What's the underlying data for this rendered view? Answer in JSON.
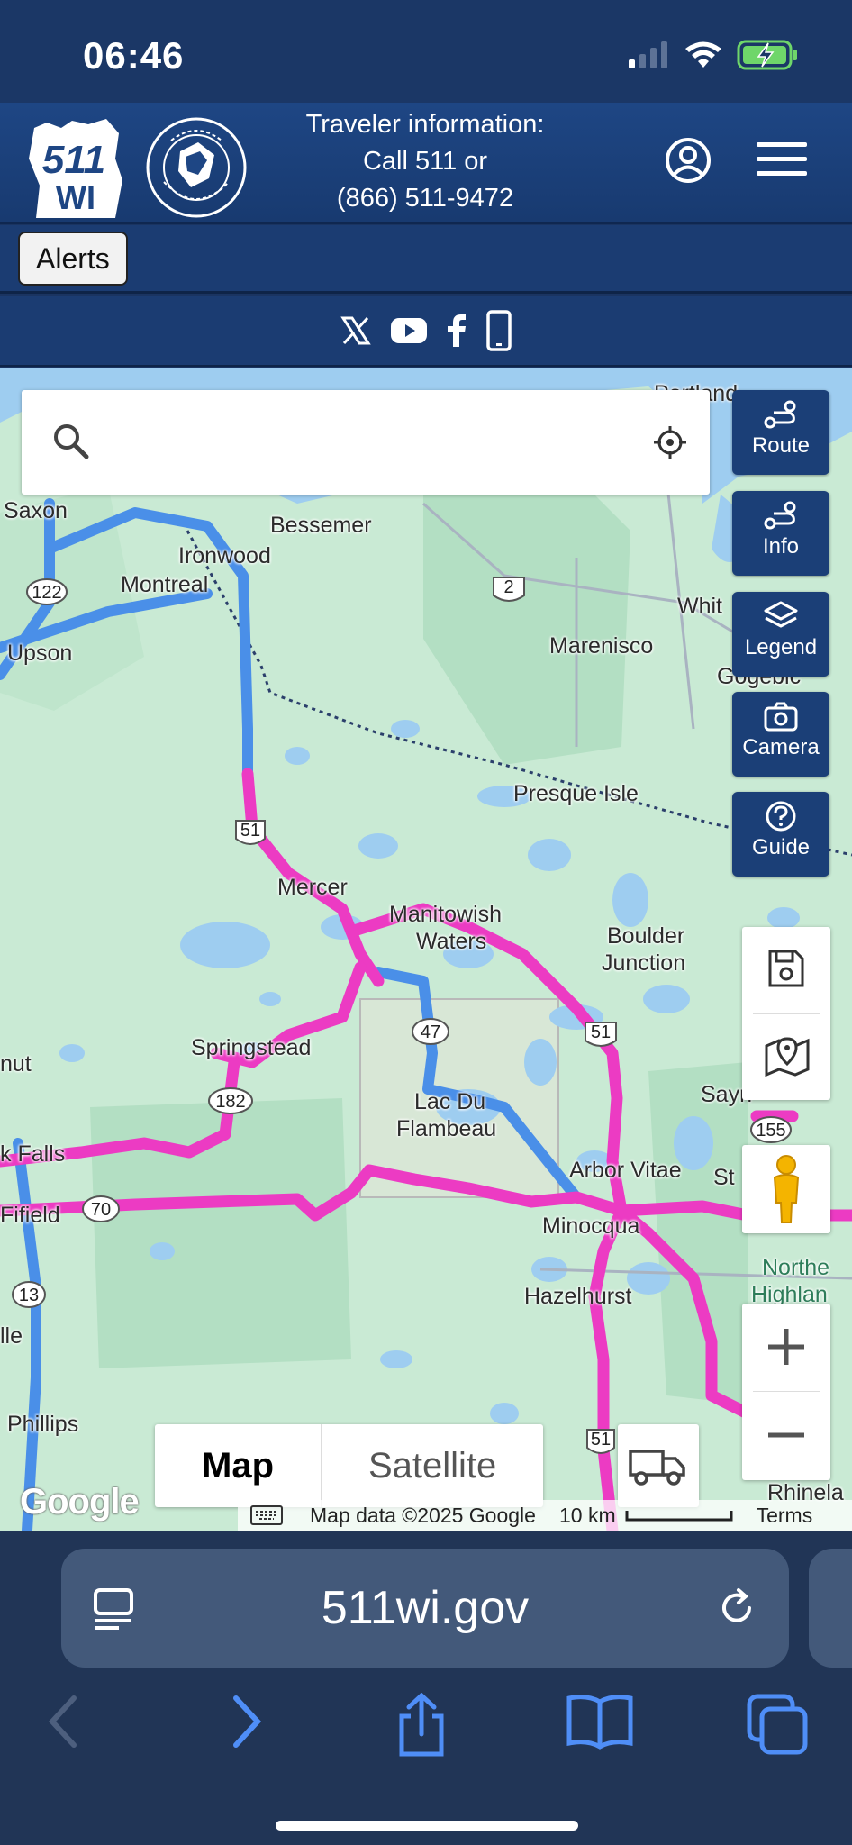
{
  "status": {
    "time": "06:46"
  },
  "header": {
    "logo_text": "511 WI",
    "agency_seal": "Wisconsin Department of Transportation",
    "info_line1": "Traveler information:",
    "info_line2": "Call 511 or",
    "info_line3": "(866) 511-9472"
  },
  "alerts": {
    "label": "Alerts"
  },
  "social": [
    "x-icon",
    "youtube-icon",
    "facebook-icon",
    "mobile-app-icon"
  ],
  "search": {
    "placeholder": "",
    "value": ""
  },
  "tools": [
    {
      "label": "Route",
      "icon": "route-icon"
    },
    {
      "label": "Info",
      "icon": "info-route-icon"
    },
    {
      "label": "Legend",
      "icon": "layers-icon"
    },
    {
      "label": "Camera",
      "icon": "camera-icon"
    },
    {
      "label": "Guide",
      "icon": "question-icon"
    }
  ],
  "map": {
    "labels": {
      "saxon": "Saxon",
      "bessemer": "Bessemer",
      "ironwood": "Ironwood",
      "montreal": "Montreal",
      "upson": "Upson",
      "marenisco": "Marenisco",
      "white": "Whit",
      "gogebic": "Gogebic",
      "presque_isle": "Presque Isle",
      "mercer": "Mercer",
      "manitowish": "Manitowish",
      "waters": "Waters",
      "boulder": "Boulder",
      "junction": "Junction",
      "springstead": "Springstead",
      "lac_du": "Lac Du",
      "flambeau": "Flambeau",
      "arbor_vitae": "Arbor Vitae",
      "minocqua": "Minocqua",
      "hazelhurst": "Hazelhurst",
      "park_falls": "k Falls",
      "fifield": "Fifield",
      "phillips": "Phillips",
      "lle": "lle",
      "nut": "nut",
      "sayner": "Sayn",
      "st_germain": "St",
      "northern": "Northe",
      "highland": "Highlan",
      "rhinelander": "Rhinela",
      "portland": "Portland"
    },
    "shields": {
      "us51a": "51",
      "us51b": "51",
      "us51c": "51",
      "us2": "2",
      "wi122": "122",
      "wi47": "47",
      "wi182": "182",
      "wi70": "70",
      "wi13": "13",
      "wi155": "155"
    },
    "map_type": {
      "map": "Map",
      "satellite": "Satellite",
      "selected": "Map"
    },
    "google": "Google",
    "attribution": "Map data ©2025 Google",
    "scale": "10 km",
    "terms": "Terms",
    "colors": {
      "water": "#9ecdf0",
      "land": "#c9ead4",
      "forest": "#b3dfc3",
      "highway_blue": "#4a8fe8",
      "incident_pink": "#ec3bc3"
    }
  },
  "browser": {
    "url": "511wi.gov"
  }
}
